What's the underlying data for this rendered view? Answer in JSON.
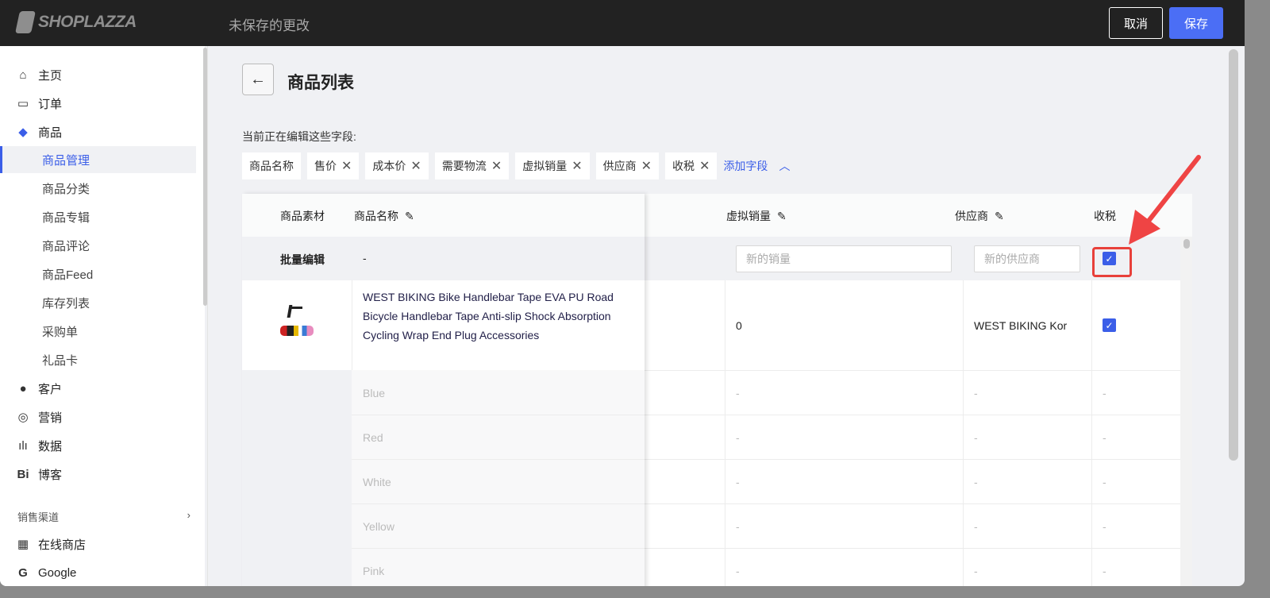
{
  "topbar": {
    "logo": "SHOPLAZZA",
    "status": "未保存的更改",
    "cancel": "取消",
    "save": "保存"
  },
  "sidebar": {
    "items": [
      {
        "label": "主页",
        "icon": "home-icon"
      },
      {
        "label": "订单",
        "icon": "inbox-icon"
      },
      {
        "label": "商品",
        "icon": "tag-icon"
      }
    ],
    "sub": [
      "商品管理",
      "商品分类",
      "商品专辑",
      "商品评论",
      "商品Feed",
      "库存列表",
      "采购单",
      "礼品卡"
    ],
    "items2": [
      {
        "label": "客户",
        "icon": "user-icon"
      },
      {
        "label": "营销",
        "icon": "marketing-icon"
      },
      {
        "label": "数据",
        "icon": "chart-icon"
      },
      {
        "label": "博客",
        "icon": "blog-icon"
      }
    ],
    "channels_label": "销售渠道",
    "channels": [
      {
        "label": "在线商店",
        "icon": "store-icon"
      },
      {
        "label": "Google",
        "icon": "google-icon"
      }
    ]
  },
  "page": {
    "title": "商品列表",
    "editing_label": "当前正在编辑这些字段:",
    "fields": [
      "商品名称",
      "售价",
      "成本价",
      "需要物流",
      "虚拟销量",
      "供应商",
      "收税"
    ],
    "add_field": "添加字段"
  },
  "table": {
    "headers": {
      "media": "商品素材",
      "name": "商品名称",
      "virtual_sales": "虚拟销量",
      "supplier": "供应商",
      "tax": "收税"
    },
    "batch": {
      "label": "批量编辑",
      "name": "-",
      "sales_placeholder": "新的销量",
      "supplier_placeholder": "新的供应商",
      "tax_checked": true
    },
    "product": {
      "name": "WEST BIKING Bike Handlebar Tape EVA PU Road Bicycle Handlebar Tape Anti-slip Shock Absorption Cycling Wrap End Plug Accessories",
      "virtual_sales": "0",
      "supplier": "WEST BIKING Kor",
      "tax_checked": true
    },
    "variants": [
      "Blue",
      "Red",
      "White",
      "Yellow",
      "Pink"
    ],
    "empty": "-"
  },
  "colors": {
    "accent": "#3b5ee8",
    "highlight": "#e8403a"
  }
}
